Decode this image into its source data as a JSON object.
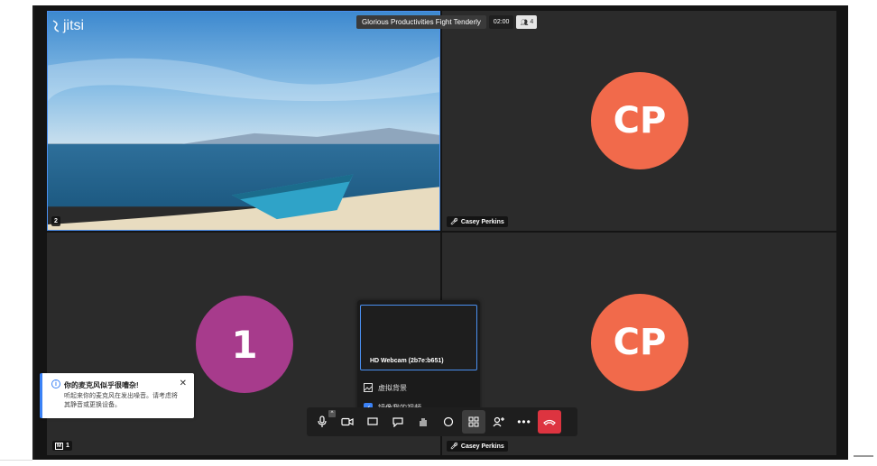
{
  "app": {
    "logo_text": "jitsi"
  },
  "header": {
    "meeting_title": "Glorious Productivities Fight Tenderly",
    "timer": "02:00",
    "participant_count": "4"
  },
  "tiles": {
    "top_left": {
      "badge": "2"
    },
    "top_right": {
      "avatar_initials": "CP",
      "name": "Casey Perkins"
    },
    "bottom_left": {
      "avatar_initials": "1",
      "badge_icon": "M",
      "badge_count": "1"
    },
    "bottom_right": {
      "avatar_initials": "CP",
      "name": "Casey Perkins"
    }
  },
  "video_menu": {
    "camera_label": "HD Webcam (2b7e:b651)",
    "virtual_background": "虚拟背景",
    "mirror_option": "镜像我的视频",
    "mirror_checked": true
  },
  "notification": {
    "title": "你的麦克风似乎很嘈杂!",
    "body": "听起来你的麦克风在发出噪音。请考虑将其静音或更换设备。"
  },
  "toolbar": {
    "buttons": [
      "microphone-icon",
      "camera-icon",
      "screen-share-icon",
      "chat-icon",
      "raise-hand-icon",
      "reactions-icon",
      "tile-view-icon",
      "invite-icon",
      "more-icon",
      "hangup-icon"
    ]
  },
  "colors": {
    "accent": "#4a8ff0",
    "avatar_cp": "#f16a4b",
    "avatar_1": "#a73b8c",
    "hangup": "#dd3440"
  }
}
